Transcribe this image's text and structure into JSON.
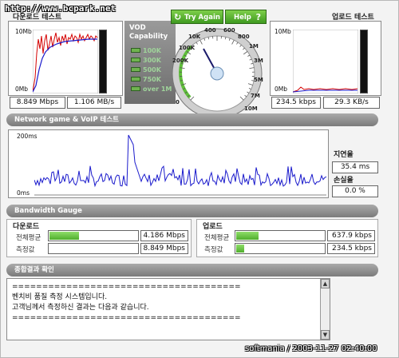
{
  "watermark_top": "http://www.bcpark.net",
  "watermark_bottom": "softmania / 2003-11-27 02:40:00",
  "download_test": {
    "title": "다운로드 테스트",
    "y_max": "10Mb",
    "y_min": "0Mb",
    "value_mbps": "8.849 Mbps",
    "value_mbs": "1.106 MB/s"
  },
  "upload_test": {
    "title": "업로드 테스트",
    "y_max": "10Mb",
    "y_min": "0Mb",
    "value_kbps": "234.5 kbps",
    "value_kbs": "29.3 KB/s"
  },
  "vod": {
    "title_line1": "VOD",
    "title_line2": "Capability",
    "levels": [
      "100K",
      "300K",
      "500K",
      "750K",
      "over 1M"
    ]
  },
  "speedometer": {
    "try_again": "Try Again",
    "help": "Help",
    "help_icon": "?",
    "refresh_icon": "refresh-icon",
    "scale": [
      "0",
      "10K",
      "100K",
      "200K",
      "400",
      "600",
      "800",
      "1M",
      "3M",
      "5M",
      "7M",
      "10M"
    ]
  },
  "network_game": {
    "section_title": "Network game & VoIP 테스트",
    "y_max": "200ms",
    "y_min": "0ms",
    "latency_label": "지연율",
    "latency_value": "35.4 ms",
    "loss_label": "손실율",
    "loss_value": "0.0 %"
  },
  "bandwidth": {
    "section_title": "Bandwidth Gauge",
    "download": {
      "title": "다운로드",
      "avg_label": "전체평균",
      "avg_value": "4.186 Mbps",
      "avg_fraction": 0.33,
      "measured_label": "측정값",
      "measured_value": "8.849 Mbps",
      "measured_fraction": 0.0
    },
    "upload": {
      "title": "업로드",
      "avg_label": "전체평균",
      "avg_value": "637.9 kbps",
      "avg_fraction": 0.25,
      "measured_label": "측정값",
      "measured_value": "234.5 kbps",
      "measured_fraction": 0.09
    }
  },
  "result": {
    "section_title": "종합결과 확인",
    "lines": [
      "======================================",
      "벤치비 품질 측정 시스템입니다.",
      "고객님께서 측정하신 결과는 다음과 같습니다.",
      "======================================"
    ]
  },
  "colors": {
    "accent_green": "#5fbf3a",
    "graph_red": "#d40000",
    "graph_blue": "#1a1acc",
    "section_gray": "#8a8a8a"
  }
}
